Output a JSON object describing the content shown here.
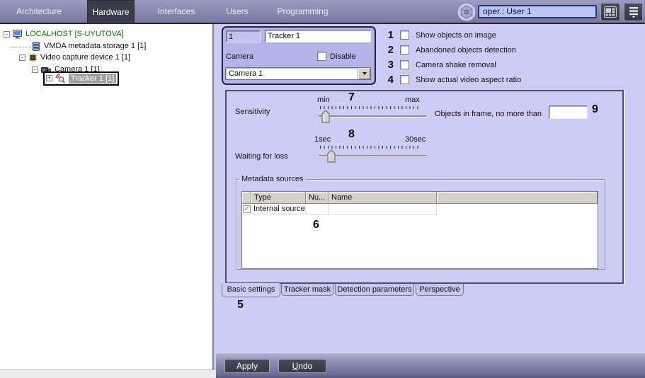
{
  "topbar": {
    "tabs": [
      {
        "label": "Architecture"
      },
      {
        "label": "Hardware"
      },
      {
        "label": "Interfaces"
      },
      {
        "label": "Users"
      },
      {
        "label": "Programming"
      }
    ],
    "active_tab": "Hardware",
    "user_field_value": "oper.: User 1"
  },
  "tree": {
    "items": [
      {
        "label": "LOCALHOST [S-UYUTOVA]",
        "expand": "-"
      },
      {
        "label": "VMDA metadata storage 1 [1]",
        "expand": ""
      },
      {
        "label": "Video capture device 1 [1]",
        "expand": "-"
      },
      {
        "label": "Camera 1 [1]",
        "expand": "-"
      },
      {
        "label": "Tracker 1 [1]",
        "expand": "+",
        "selected": true
      }
    ]
  },
  "form": {
    "id_value": "1",
    "name_value": "Tracker 1",
    "camera_label": "Camera",
    "disable_label": "Disable",
    "camera_select_value": "Camera 1",
    "option_checkboxes": [
      {
        "num": "1",
        "label": "Show objects on image",
        "checked": false
      },
      {
        "num": "2",
        "label": "Abandoned objects detection",
        "checked": false
      },
      {
        "num": "3",
        "label": "Camera shake removal",
        "checked": false
      },
      {
        "num": "4",
        "label": "Show actual video aspect ratio",
        "checked": false
      }
    ],
    "sensitivity": {
      "label": "Sensitivity",
      "min_label": "min",
      "max_label": "max",
      "num": "7"
    },
    "objects_in_frame": {
      "label": "Objects in frame, no more than",
      "value": "",
      "num": "9"
    },
    "waiting_for_loss": {
      "label": "Waiting for loss",
      "min_label": "1sec",
      "max_label": "30sec",
      "num": "8"
    },
    "metadata_sources": {
      "title": "Metadata sources",
      "num": "6",
      "columns": [
        "Type",
        "Nu...",
        "Name"
      ],
      "rows": [
        {
          "checked": true,
          "type": "Internal source",
          "number": "",
          "name": ""
        }
      ]
    },
    "page_tabs": [
      {
        "label": "Basic settings",
        "active": true,
        "num": "5"
      },
      {
        "label": "Tracker mask",
        "active": false
      },
      {
        "label": "Detection parameters",
        "active": false
      },
      {
        "label": "Perspective",
        "active": false
      }
    ],
    "buttons": {
      "apply": "Apply",
      "undo_first": "U",
      "undo_rest": "ndo"
    }
  },
  "icons": {
    "dropdown-arrow": "▼",
    "checkbox-check": "✓",
    "tree-collapse": "-",
    "tree-expand": "+"
  },
  "colors": {
    "topbar_bg": "#8787af",
    "topbar_active_tab": "#3b3b49",
    "panel_bg": "#ccccf4",
    "header_box_bg": "#b4b4e8",
    "header_box_border": "#20204a",
    "tree_selection_bg": "#9e9e9e",
    "localhost_text": "#007d00",
    "user_field_bg": "#b9c6f2",
    "dark_button_bg": "#3f3f4e",
    "table_header_bg": "#d5d1c9"
  }
}
